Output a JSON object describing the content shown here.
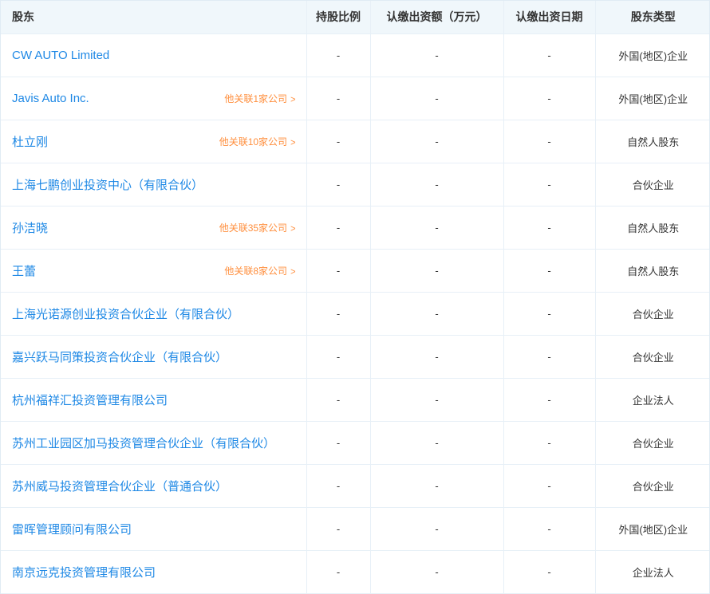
{
  "colors": {
    "link_blue": "#1e88e5",
    "link_orange": "#ff8f3e",
    "header_bg": "#f0f7fb",
    "border": "#e7f0f7",
    "text": "#333333"
  },
  "icons": {
    "chevron_right": ">"
  },
  "table": {
    "columns": [
      {
        "label": "股东"
      },
      {
        "label": "持股比例"
      },
      {
        "label": "认缴出资额（万元）"
      },
      {
        "label": "认缴出资日期"
      },
      {
        "label": "股东类型"
      }
    ],
    "rows": [
      {
        "name": "CW AUTO Limited",
        "related": "",
        "ratio": "-",
        "amount": "-",
        "date": "-",
        "type": "外国(地区)企业"
      },
      {
        "name": "Javis Auto Inc.",
        "related": "他关联1家公司",
        "ratio": "-",
        "amount": "-",
        "date": "-",
        "type": "外国(地区)企业"
      },
      {
        "name": "杜立刚",
        "related": "他关联10家公司",
        "ratio": "-",
        "amount": "-",
        "date": "-",
        "type": "自然人股东"
      },
      {
        "name": "上海七鹏创业投资中心（有限合伙）",
        "related": "",
        "ratio": "-",
        "amount": "-",
        "date": "-",
        "type": "合伙企业"
      },
      {
        "name": "孙洁晓",
        "related": "他关联35家公司",
        "ratio": "-",
        "amount": "-",
        "date": "-",
        "type": "自然人股东"
      },
      {
        "name": "王蕾",
        "related": "他关联8家公司",
        "ratio": "-",
        "amount": "-",
        "date": "-",
        "type": "自然人股东"
      },
      {
        "name": "上海光诺源创业投资合伙企业（有限合伙）",
        "related": "",
        "ratio": "-",
        "amount": "-",
        "date": "-",
        "type": "合伙企业"
      },
      {
        "name": "嘉兴跃马同策投资合伙企业（有限合伙）",
        "related": "",
        "ratio": "-",
        "amount": "-",
        "date": "-",
        "type": "合伙企业"
      },
      {
        "name": "杭州福祥汇投资管理有限公司",
        "related": "",
        "ratio": "-",
        "amount": "-",
        "date": "-",
        "type": "企业法人"
      },
      {
        "name": "苏州工业园区加马投资管理合伙企业（有限合伙）",
        "related": "",
        "ratio": "-",
        "amount": "-",
        "date": "-",
        "type": "合伙企业"
      },
      {
        "name": "苏州威马投资管理合伙企业（普通合伙）",
        "related": "",
        "ratio": "-",
        "amount": "-",
        "date": "-",
        "type": "合伙企业"
      },
      {
        "name": "雷晖管理顾问有限公司",
        "related": "",
        "ratio": "-",
        "amount": "-",
        "date": "-",
        "type": "外国(地区)企业"
      },
      {
        "name": "南京远克投资管理有限公司",
        "related": "",
        "ratio": "-",
        "amount": "-",
        "date": "-",
        "type": "企业法人"
      }
    ]
  }
}
